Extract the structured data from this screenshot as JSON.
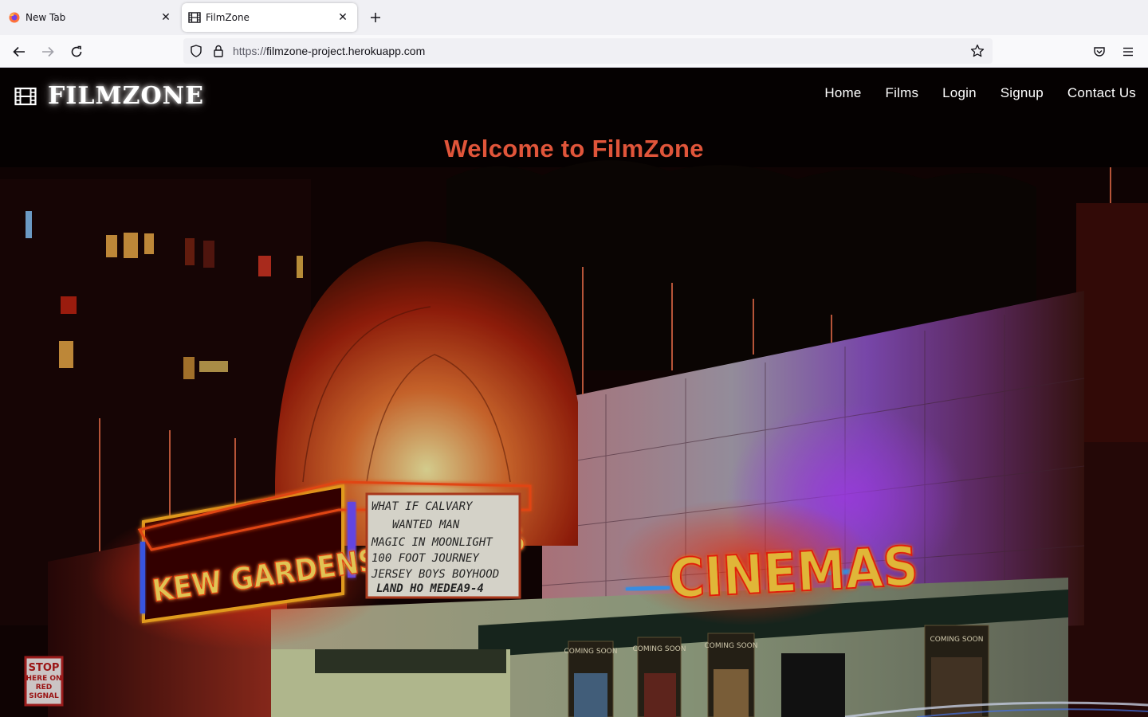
{
  "browser": {
    "tabs": [
      {
        "title": "New Tab",
        "icon": "firefox-icon",
        "active": false
      },
      {
        "title": "FilmZone",
        "icon": "film-icon",
        "active": true
      }
    ],
    "url_scheme": "https://",
    "url_host": "filmzone-project.herokuapp.com"
  },
  "site": {
    "brand": "FILMZONE",
    "nav": [
      "Home",
      "Films",
      "Login",
      "Signup",
      "Contact Us"
    ],
    "welcome": "Welcome to FilmZone",
    "accent_color": "#e0553a"
  },
  "hero_image": {
    "left_marquee_sign": "KEW GARDENS CINEMAS",
    "right_marquee_sign": "CINEMAS",
    "marquee_board_lines": [
      "WHAT IF     CALVARY",
      "WANTED MAN",
      "MAGIC IN MOONLIGHT",
      "100 FOOT JOURNEY",
      "JERSEY BOYS BOYHOOD",
      "LAND HO     MEDEA9-4"
    ],
    "stop_sign_lines": [
      "STOP",
      "HERE ON",
      "RED",
      "SIGNAL"
    ],
    "coming_soon_posters": [
      "COMING SOON",
      "COMING SOON",
      "COMING SOON",
      "COMING SOON"
    ]
  }
}
